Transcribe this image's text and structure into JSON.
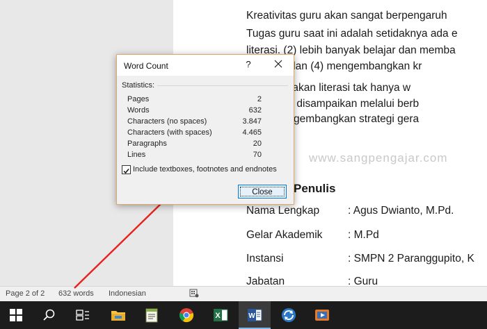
{
  "document": {
    "lines": [
      "Kreativitas guru akan sangat berpengaruh",
      "Tugas guru saat ini adalah setidaknya ada e",
      "literasi. (2) lebih banyak belajar dan memba",
      "ensinya, dan (4) mengembangkan kr",
      "harap gerakan literasi tak hanya w",
      "teori yang disampaikan melalui berb",
      "alam mengembangkan strategi gera"
    ],
    "watermark": "www.sangpengajar.com",
    "heading": "Penulis",
    "profile": [
      {
        "label": "Nama Lengkap",
        "value": ":  Agus Dwianto, M.Pd."
      },
      {
        "label": "Gelar Akademik",
        "value": ": M.Pd"
      },
      {
        "label": "Instansi",
        "value": ": SMPN 2 Paranggupito, K"
      },
      {
        "label": "Jabatan",
        "value": ": Guru"
      }
    ]
  },
  "dialog": {
    "title": "Word Count",
    "help": "?",
    "statistics_label": "Statistics:",
    "stats": [
      {
        "name": "Pages",
        "value": "2"
      },
      {
        "name": "Words",
        "value": "632"
      },
      {
        "name": "Characters (no spaces)",
        "value": "3.847"
      },
      {
        "name": "Characters (with spaces)",
        "value": "4.465"
      },
      {
        "name": "Paragraphs",
        "value": "20"
      },
      {
        "name": "Lines",
        "value": "70"
      }
    ],
    "include_label": "Include textboxes, footnotes and endnotes",
    "include_checked": true,
    "close_label": "Close"
  },
  "status_bar": {
    "page": "Page 2 of 2",
    "words": "632 words",
    "language": "Indonesian"
  },
  "taskbar": {
    "icons": [
      "windows-start-icon",
      "search-icon",
      "task-view-icon",
      "file-explorer-icon",
      "notepad-icon",
      "chrome-icon",
      "excel-icon",
      "word-icon",
      "sync-icon",
      "media-player-icon"
    ]
  },
  "colors": {
    "annotation_arrow": "#e8221b",
    "dialog_border": "#e0a86c",
    "taskbar": "#1c1c1c",
    "word_blue": "#2b579a",
    "excel_green": "#217346"
  }
}
